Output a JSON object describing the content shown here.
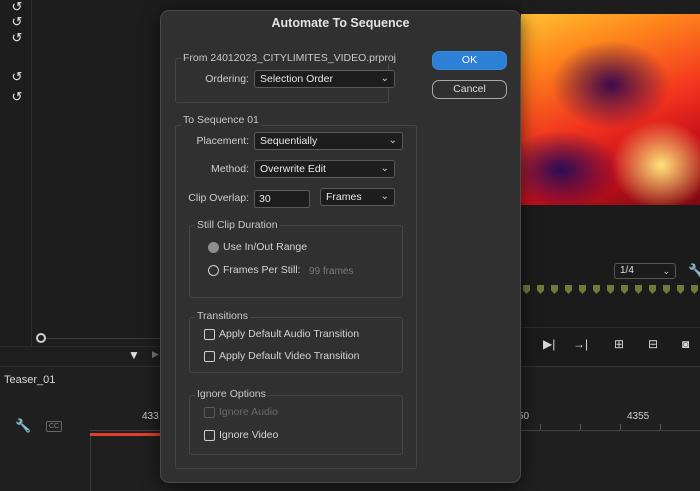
{
  "background": {
    "sequence_name": "Teaser_01",
    "timecodes": [
      "433",
      "50",
      "4355"
    ],
    "zoom_level": "1/4"
  },
  "dialog": {
    "title": "Automate To Sequence",
    "from_group": {
      "legend": "From 24012023_CITYLIMITES_VIDEO.prproj",
      "ordering_label": "Ordering:",
      "ordering_value": "Selection Order"
    },
    "to_group": {
      "legend": "To Sequence 01",
      "placement_label": "Placement:",
      "placement_value": "Sequentially",
      "method_label": "Method:",
      "method_value": "Overwrite Edit",
      "clip_overlap_label": "Clip Overlap:",
      "clip_overlap_value": "30",
      "clip_overlap_unit": "Frames"
    },
    "still_clip": {
      "legend": "Still Clip Duration",
      "use_in_out": "Use In/Out Range",
      "frames_per_still": "Frames Per Still:",
      "frames_value": "99 frames"
    },
    "transitions": {
      "legend": "Transitions",
      "audio": "Apply Default Audio Transition",
      "video": "Apply Default Video Transition"
    },
    "ignore": {
      "legend": "Ignore Options",
      "audio": "Ignore Audio",
      "video": "Ignore Video"
    },
    "buttons": {
      "ok": "OK",
      "cancel": "Cancel"
    }
  },
  "colors": {
    "accent": "#2e7fd6",
    "playhead": "#e0402a",
    "marker": "#6c7a3a"
  }
}
